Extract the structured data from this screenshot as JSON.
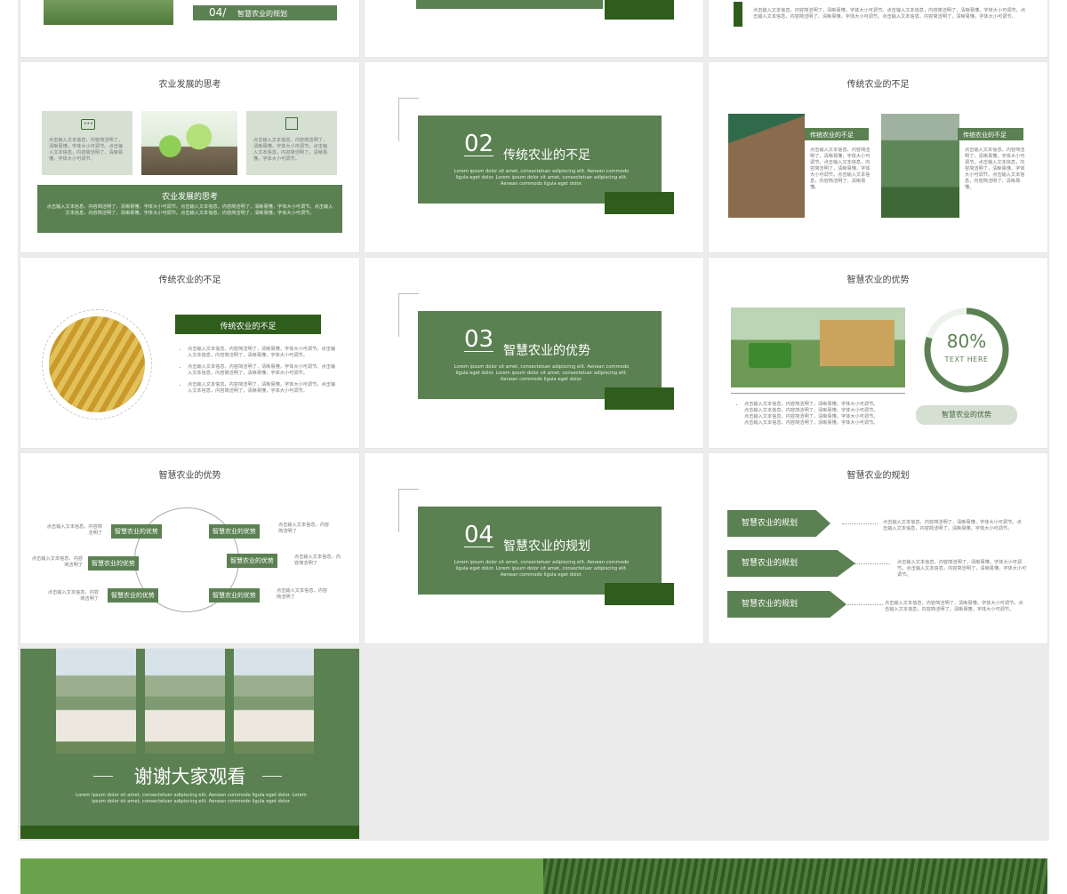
{
  "colors": {
    "accent": "#5b8152",
    "dark_accent": "#2f5d1c",
    "sage": "#d5e0d3"
  },
  "slides": {
    "top_left": {
      "label_number": "04/",
      "label_text": "智慧农业的规划"
    },
    "top_right": {
      "text": "点击输入文本信息，内容简洁明了，清晰易懂，字体大小可调节。点击输入文本信息，内容简洁明了，清晰易懂，字体大小可调节。点击输入文本信息，内容简洁明了，清晰易懂，字体大小可调节。点击输入文本信息，内容简洁明了，清晰易懂，字体大小可调节。"
    },
    "agri_thinking": {
      "title": "农业发展的思考",
      "card_text": "点击输入文本信息，内容简洁明了，清晰易懂，字体大小可调节。点击输入文本信息，内容简洁明了，清晰易懂，字体大小可调节。",
      "box_title": "农业发展的思考",
      "box_text": "点击输入文本信息，内容简洁明了，清晰易懂，字体大小可调节。点击输入文本信息，内容简洁明了，清晰易懂，字体大小可调节。点击输入文本信息，内容简洁明了，清晰易懂，字体大小可调节。点击输入文本信息，内容简洁明了，清晰易懂，字体大小可调节。"
    },
    "section02": {
      "number": "02",
      "title": "传统农业的不足",
      "sub": "Lorem ipsum dolor sit amet, consectetuer adipiscing elit. Aenean commodo ligula eget dolor. Lorem ipsum dolor sit amet, consectetuer adipiscing elit. Aenean commodo ligula eget dolor."
    },
    "traditional_photos": {
      "title": "传统农业的不足",
      "label_left": "传统农业的不足",
      "label_right": "传统农业的不足",
      "text": "点击输入文本信息，内容简洁明了，清晰易懂，字体大小可调节。点击输入文本信息，内容简洁明了，清晰易懂，字体大小可调节。点击输入文本信息，内容简洁明了，清晰易懂。"
    },
    "traditional_list": {
      "title": "传统农业的不足",
      "pill": "传统农业的不足",
      "items": [
        "点击输入文本信息，内容简洁明了，清晰易懂，字体大小可调节。点击输入文本信息，内容简洁明了，清晰易懂，字体大小可调节。",
        "点击输入文本信息，内容简洁明了，清晰易懂，字体大小可调节。点击输入文本信息，内容简洁明了，清晰易懂，字体大小可调节。",
        "点击输入文本信息，内容简洁明了，清晰易懂，字体大小可调节。点击输入文本信息，内容简洁明了，清晰易懂，字体大小可调节。"
      ]
    },
    "section03": {
      "number": "03",
      "title": "智慧农业的优势",
      "sub": "Lorem ipsum dolor sit amet, consectetuer adipiscing elit. Aenean commodo ligula eget dolor. Lorem ipsum dolor sit amet, consectetuer adipiscing elit. Aenean commodo ligula eget dolor."
    },
    "smart_advantage_ring": {
      "title": "智慧农业的优势",
      "percent": "80%",
      "percent_value": 0.8,
      "percent_caption": "TEXT HERE",
      "pill": "智慧农业的优势",
      "items": [
        "点击输入文本信息，内容简洁明了，清晰易懂，字体大小可调节。",
        "点击输入文本信息，内容简洁明了，清晰易懂，字体大小可调节。",
        "点击输入文本信息，内容简洁明了，清晰易懂，字体大小可调节。",
        "点击输入文本信息，内容简洁明了，清晰易懂，字体大小可调节。"
      ]
    },
    "smart_advantage_circle": {
      "title": "智慧农业的优势",
      "node_label": "智慧农业的优势",
      "side_text": "点击输入文本信息，内容简洁明了"
    },
    "section04": {
      "number": "04",
      "title": "智慧农业的规划",
      "sub": "Lorem ipsum dolor sit amet, consectetuer adipiscing elit. Aenean commodo ligula eget dolor. Lorem ipsum dolor sit amet, consectetuer adipiscing elit. Aenean commodo ligula eget dolor."
    },
    "smart_plan": {
      "title": "智慧农业的规划",
      "arrows": [
        "智慧农业的规划",
        "智慧农业的规划",
        "智慧农业的规划"
      ],
      "text": "点击输入文本信息，内容简洁明了，清晰易懂，字体大小可调节。点击输入文本信息，内容简洁明了，清晰易懂，字体大小可调节。"
    },
    "thanks": {
      "title": "谢谢大家观看",
      "sub": "Lorem ipsum dolor sit amet, consectetuer adipiscing elit. Aenean commodo ligula eget dolor. Lorem ipsum dolor sit amet, consectetuer adipiscing elit. Aenean commodo ligula eget dolor."
    }
  }
}
